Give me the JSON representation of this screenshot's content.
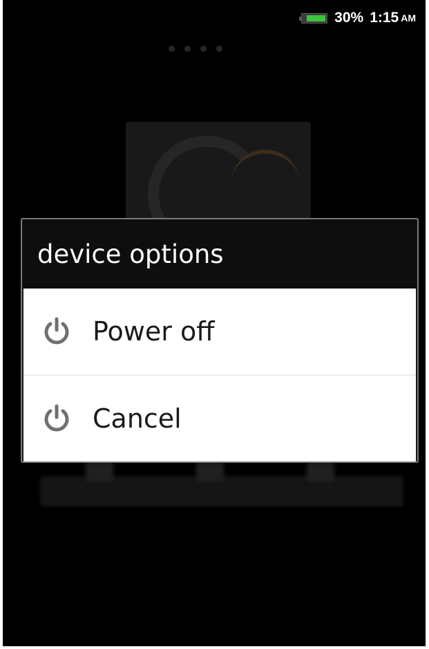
{
  "status_bar": {
    "battery_level": 0.3,
    "battery_color": "#3ec43e",
    "battery_text": "30%",
    "time": "1:15",
    "ampm": "AM"
  },
  "dialog": {
    "title": "device options",
    "items": [
      {
        "label": "Power off",
        "icon": "power-icon"
      },
      {
        "label": "Cancel",
        "icon": "power-icon"
      }
    ]
  },
  "colors": {
    "dialog_title_bg": "#0e0e0e",
    "dialog_list_bg": "#ffffff",
    "icon_gray": "#707070"
  }
}
